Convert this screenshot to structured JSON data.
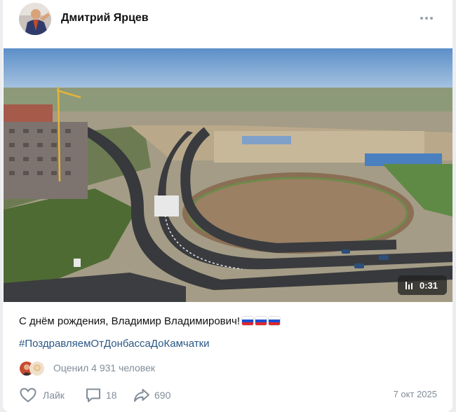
{
  "post": {
    "author": "Дмитрий Ярцев",
    "text": "С днём рождения, Владимир Владимирович!",
    "hashtag": "#ПоздравляемОтДонбассаДоКамчатки",
    "video_duration": "0:31",
    "rated_by": "Оценил 4 931 человек",
    "date": "7 окт 2025"
  },
  "actions": {
    "like_label": "Лайк",
    "comments_count": "18",
    "shares_count": "690"
  },
  "icons": [
    "more-icon",
    "video-duration-icon",
    "russia-flag-icon",
    "heart-icon",
    "comment-icon",
    "share-icon"
  ],
  "colors": {
    "link": "#2a5885",
    "muted": "#818c99"
  }
}
